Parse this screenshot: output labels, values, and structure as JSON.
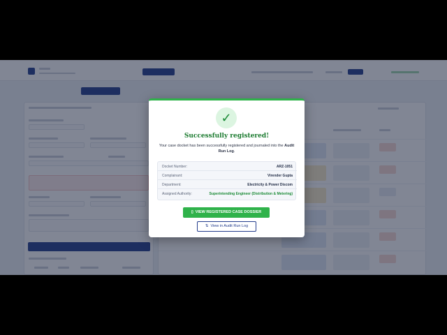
{
  "modal": {
    "title": "Successfully registered!",
    "check_icon": "✓",
    "message_part1": "Your case docket has been successfully registered and journaled into the",
    "message_bold": "Audit Run Log",
    "message_end": ".",
    "details": [
      {
        "label": "Docket Number:",
        "value": "ARZ-1051"
      },
      {
        "label": "Complainant:",
        "value": "Virender Gupta"
      },
      {
        "label": "Department:",
        "value": "Electricity & Power Discom"
      },
      {
        "label": "Assigned Authority:",
        "value": "Superintending Engineer (Distribution & Metering)"
      }
    ],
    "primary_button": "VIEW REGISTERED CASE DOSSIER",
    "primary_icon": "▯",
    "secondary_button": "View in Audit Run Log",
    "secondary_icon": "⇅"
  },
  "colors": {
    "success": "#2fb24a",
    "success_text": "#1a7a2e",
    "primary": "#233c8c",
    "overlay": "#19233c"
  }
}
